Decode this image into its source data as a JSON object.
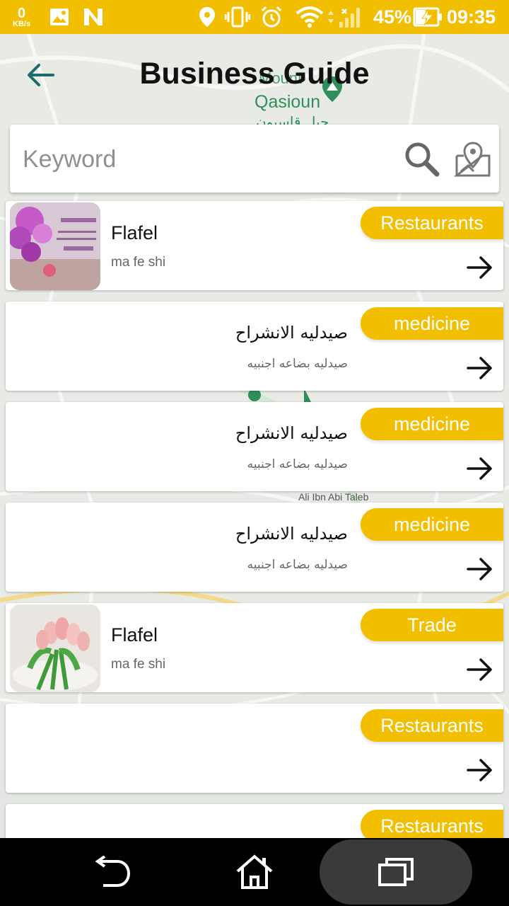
{
  "status_bar": {
    "net_speed_value": "0",
    "net_speed_unit": "KB/s",
    "battery": "45%",
    "time": "09:35"
  },
  "header": {
    "title": "Business Guide"
  },
  "map_labels": {
    "mount": "Mount",
    "qasioun": "Qasioun",
    "qasioun_ar": "جبل قاسيون",
    "street_1": "Ali Ibn Abi Taleb"
  },
  "search": {
    "placeholder": "Keyword"
  },
  "cards": [
    {
      "name": "Flafel",
      "description": "ma fe shi",
      "category": "Restaurants",
      "has_image": true,
      "image_subject": "pink-flowers-greeting-card"
    },
    {
      "name": "صيدليه الانشراح",
      "description": "صيدليه بضاعه اجنبيه",
      "category": "medicine",
      "has_image": false
    },
    {
      "name": "صيدليه الانشراح",
      "description": "صيدليه بضاعه اجنبيه",
      "category": "medicine",
      "has_image": false
    },
    {
      "name": "صيدليه الانشراح",
      "description": "صيدليه بضاعه اجنبيه",
      "category": "medicine",
      "has_image": false
    },
    {
      "name": "Flafel",
      "description": "ma fe shi",
      "category": "Trade",
      "has_image": true,
      "image_subject": "pink-tulips-bouquet"
    },
    {
      "name": "",
      "description": "",
      "category": "Restaurants",
      "has_image": false
    },
    {
      "name": "",
      "description": "",
      "category": "Restaurants",
      "has_image": false
    }
  ],
  "colors": {
    "accent": "#f2bf00",
    "back_arrow": "#1f6b6b"
  }
}
